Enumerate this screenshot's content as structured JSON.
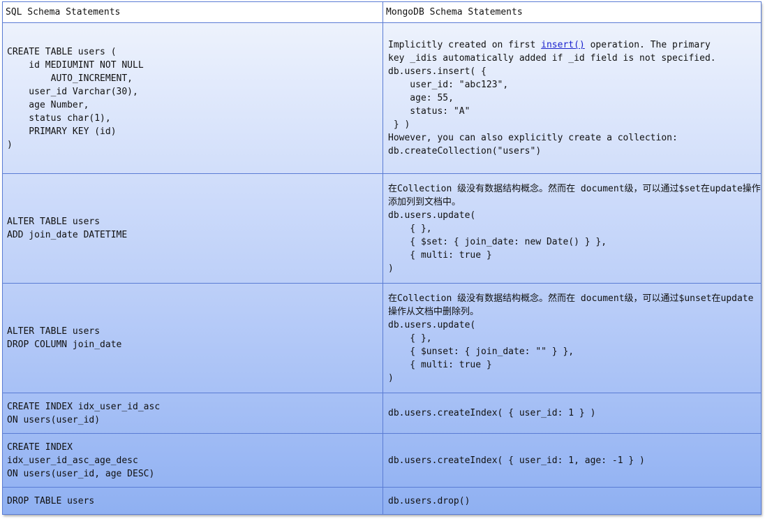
{
  "header": {
    "sql": "SQL Schema Statements",
    "mongo": "MongoDB Schema Statements"
  },
  "rows": [
    {
      "sql": "CREATE TABLE users (\n    id MEDIUMINT NOT NULL\n        AUTO_INCREMENT,\n    user_id Varchar(30),\n    age Number,\n    status char(1),\n    PRIMARY KEY (id)\n)",
      "mongo_intro_before": "Implicitly created on first ",
      "mongo_intro_link": "insert()",
      "mongo_intro_after": " operation. The primary\nkey _idis automatically added if _id field is not specified.",
      "mongo_code": "db.users.insert( {\n    user_id: \"abc123\",\n    age: 55,\n    status: \"A\"\n } )\nHowever, you can also explicitly create a collection:\ndb.createCollection(\"users\")"
    },
    {
      "sql": "ALTER TABLE users\nADD join_date DATETIME",
      "mongo_intro": "在Collection 级没有数据结构概念。然而在 document级，可以通过$set在update操作添加列到文档中。",
      "mongo_code": "db.users.update(\n    { },\n    { $set: { join_date: new Date() } },\n    { multi: true }\n)"
    },
    {
      "sql": "ALTER TABLE users\nDROP COLUMN join_date",
      "mongo_intro": "在Collection 级没有数据结构概念。然而在 document级，可以通过$unset在update操作从文档中删除列。",
      "mongo_code": "db.users.update(\n    { },\n    { $unset: { join_date: \"\" } },\n    { multi: true }\n)"
    },
    {
      "sql": "CREATE INDEX idx_user_id_asc\nON users(user_id)",
      "mongo": "db.users.createIndex( { user_id: 1 } )"
    },
    {
      "sql": "CREATE INDEX\nidx_user_id_asc_age_desc\nON users(user_id, age DESC)",
      "mongo": "db.users.createIndex( { user_id: 1, age: -1 } )"
    },
    {
      "sql": "DROP TABLE users",
      "mongo": "db.users.drop()"
    }
  ]
}
